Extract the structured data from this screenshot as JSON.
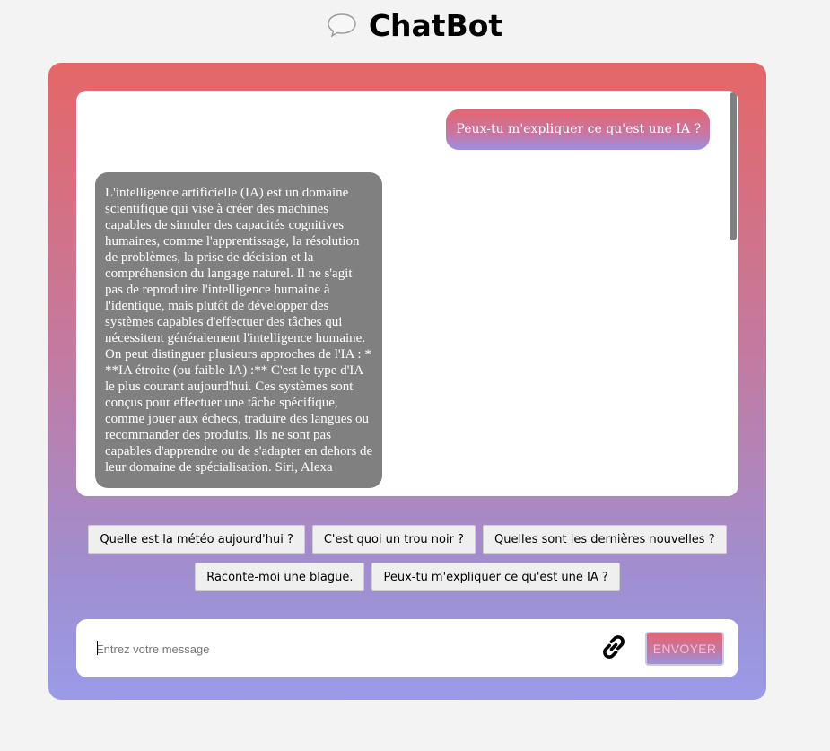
{
  "header": {
    "title": "ChatBot",
    "icon": "speech-bubble-icon"
  },
  "chat": {
    "messages": [
      {
        "role": "user",
        "text": "Peux-tu m'expliquer ce qu'est une IA ?"
      },
      {
        "role": "bot",
        "text": "L'intelligence artificielle (IA) est un domaine scientifique qui vise à créer des machines capables de simuler des capacités cognitives humaines, comme l'apprentissage, la résolution de problèmes, la prise de décision et la compréhension du langage naturel. Il ne s'agit pas de reproduire l'intelligence humaine à l'identique, mais plutôt de développer des systèmes capables d'effectuer des tâches qui nécessitent généralement l'intelligence humaine. On peut distinguer plusieurs approches de l'IA : * **IA étroite (ou faible IA) :** C'est le type d'IA le plus courant aujourd'hui. Ces systèmes sont conçus pour effectuer une tâche spécifique, comme jouer aux échecs, traduire des langues ou recommander des produits. Ils ne sont pas capables d'apprendre ou de s'adapter en dehors de leur domaine de spécialisation. Siri, Alexa"
      }
    ]
  },
  "suggestions": [
    "Quelle est la météo aujourd'hui ?",
    "C'est quoi un trou noir ?",
    "Quelles sont les dernières nouvelles ?",
    "Raconte-moi une blague.",
    "Peux-tu m'expliquer ce qu'est une IA ?"
  ],
  "composer": {
    "placeholder": "Entrez votre message",
    "value": "",
    "attach_icon": "link-icon",
    "send_label": "ENVOYER"
  },
  "colors": {
    "background": "#f3f3f3",
    "panel_top": "#e46768",
    "panel_bottom": "#9a9be8",
    "bot_bubble": "#808080"
  }
}
